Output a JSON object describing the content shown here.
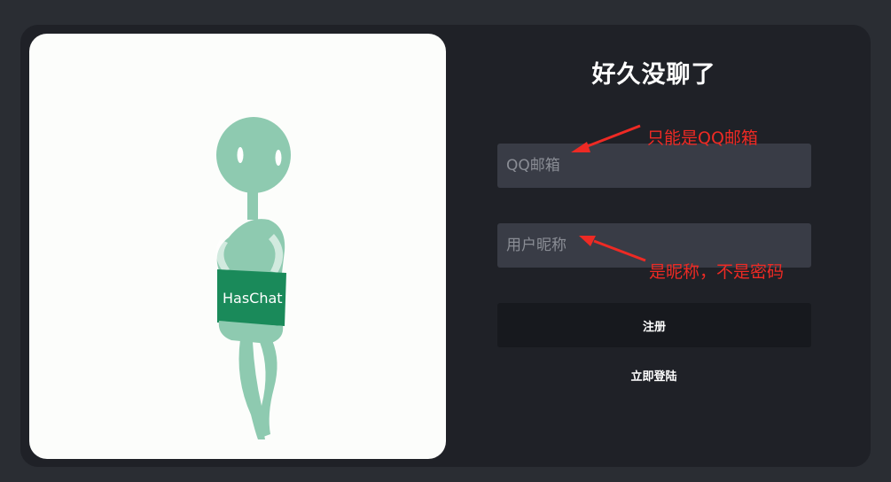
{
  "login_form": {
    "title": "好久没聊了",
    "email_placeholder": "QQ邮箱",
    "nickname_placeholder": "用户昵称",
    "register_label": "注册",
    "login_link": "立即登陆"
  },
  "illustration": {
    "shirt_text": "HasChat",
    "icon": "stick-figure-mascot"
  },
  "annotations": {
    "email_note": "只能是QQ邮箱",
    "nickname_note": "是昵称，不是密码",
    "color": "#ee2a24"
  },
  "colors": {
    "page_bg": "#2a2d33",
    "card_bg": "#1f2127",
    "input_bg": "#393c46",
    "button_bg": "#17191e",
    "mascot_green": "#8ecab0",
    "shirt_green": "#1a8a5a"
  }
}
